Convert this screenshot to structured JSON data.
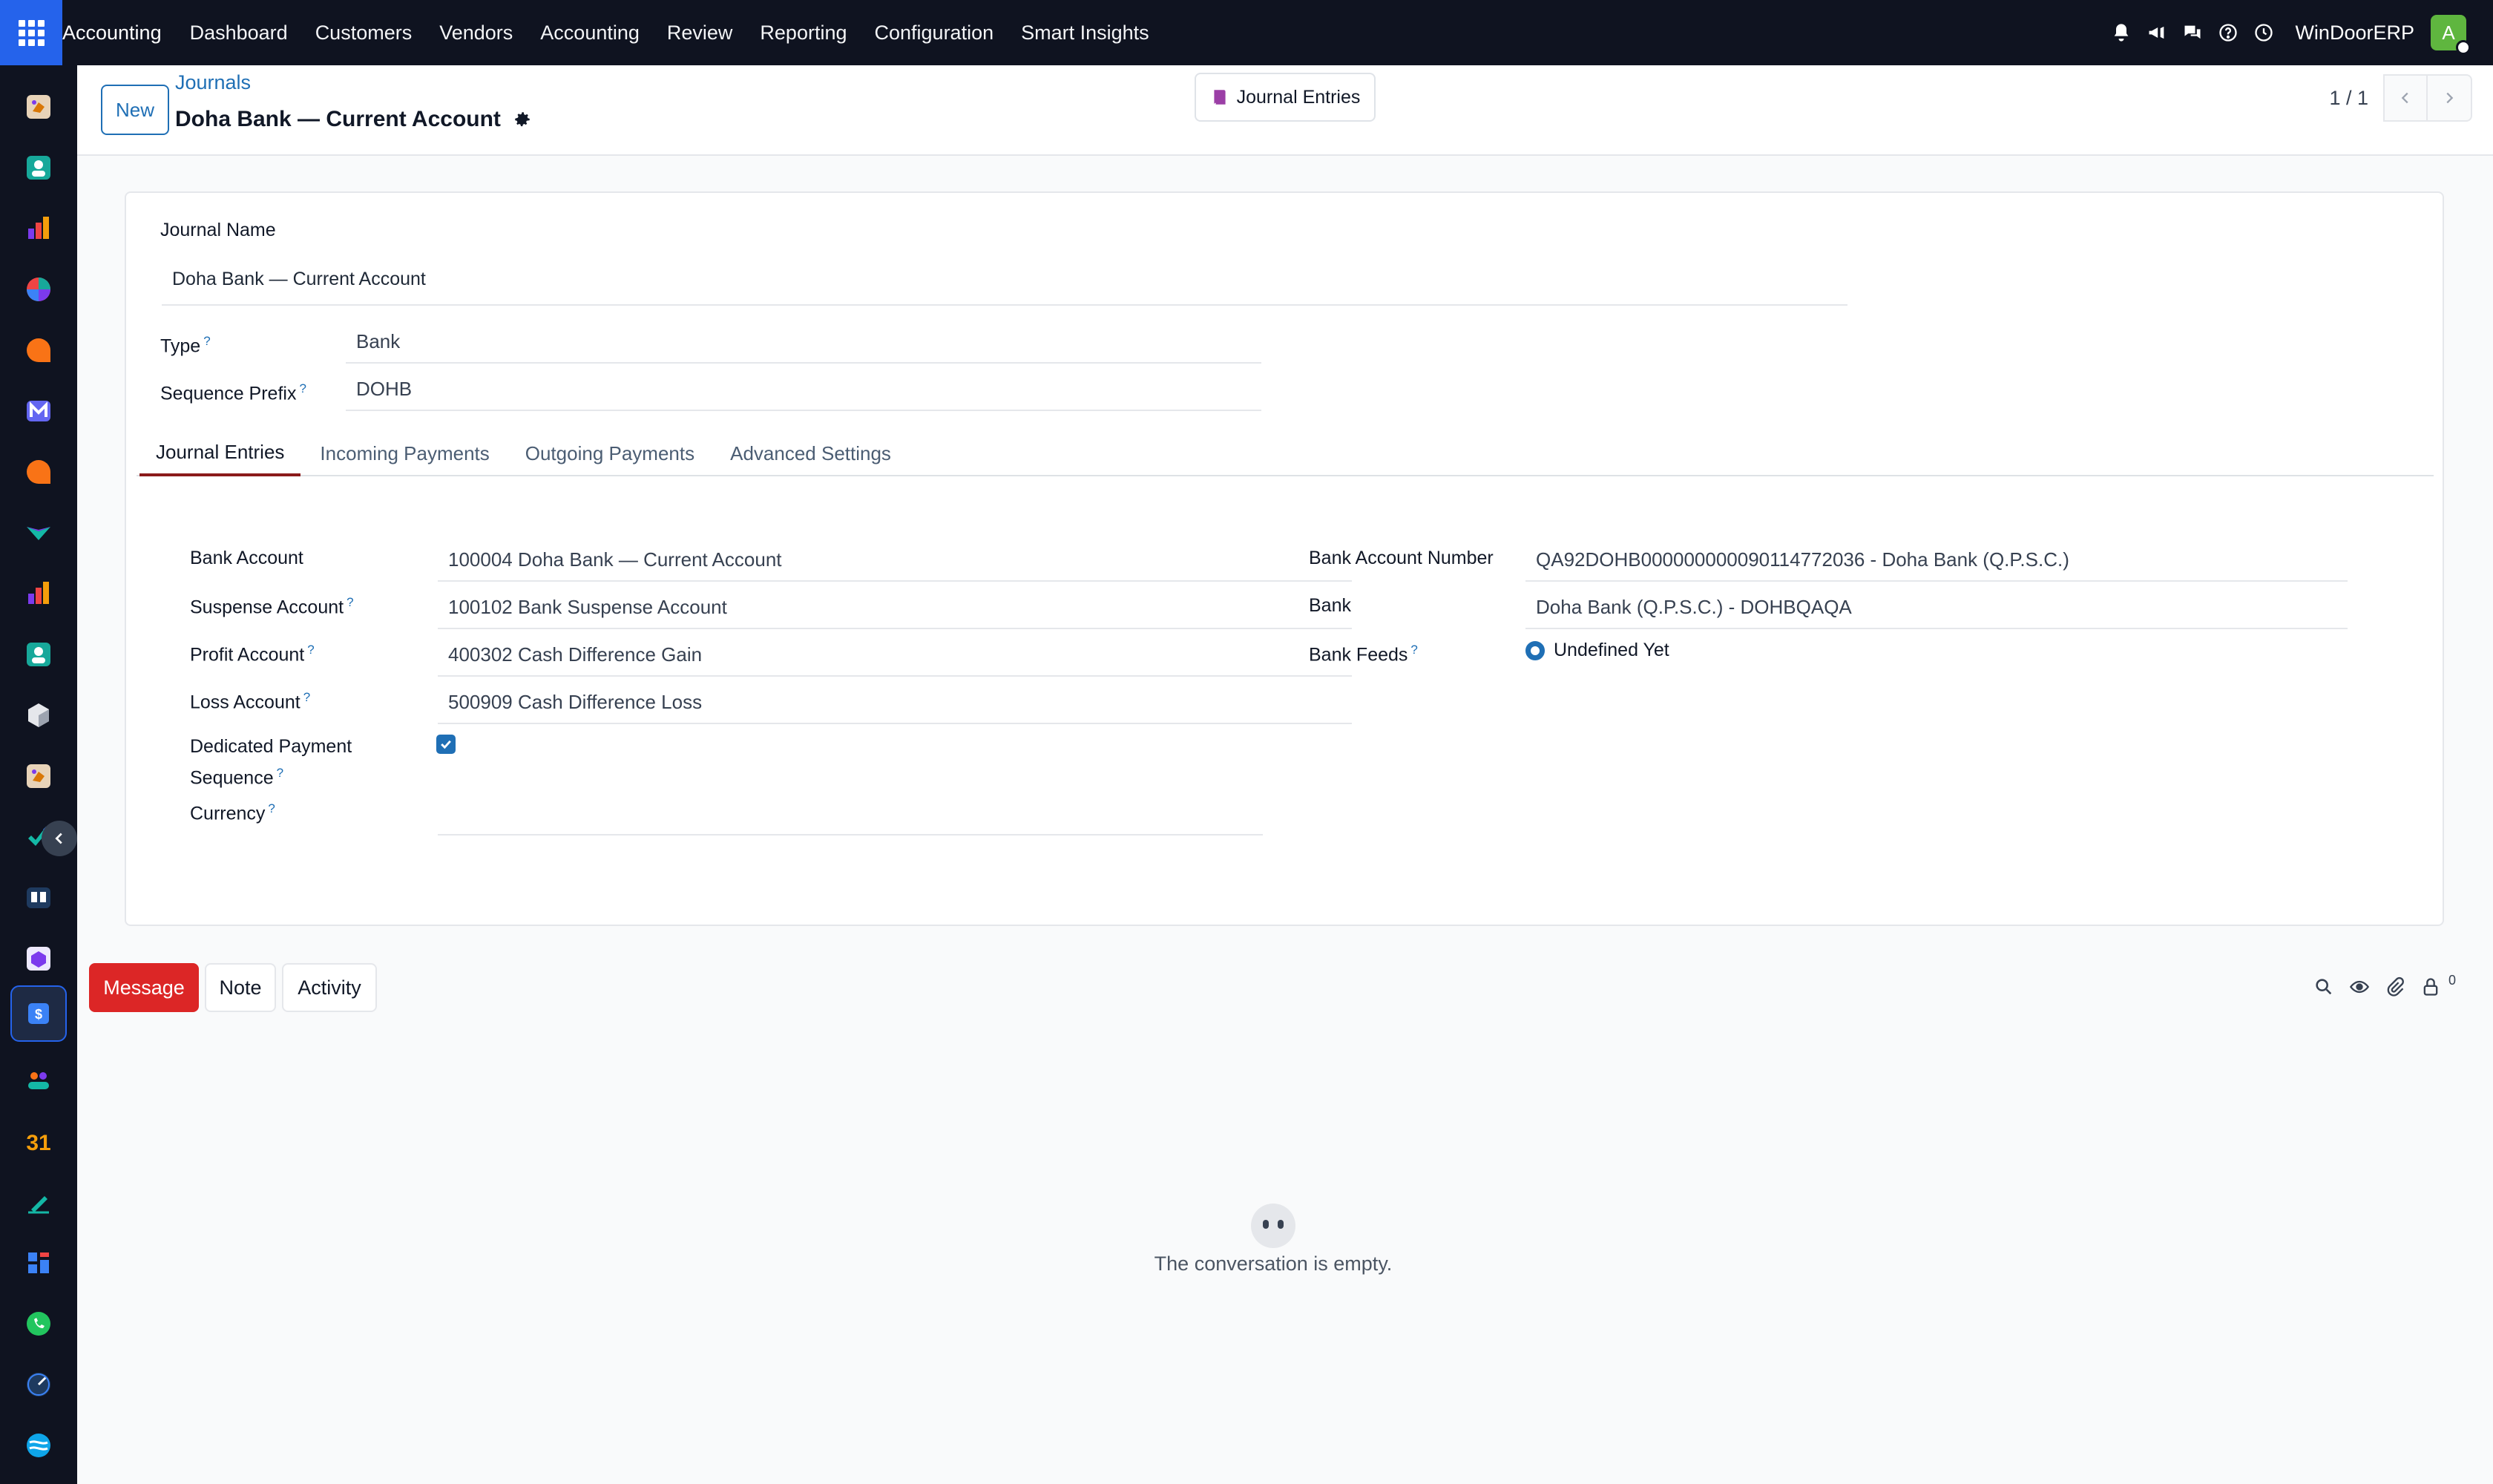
{
  "topbar": {
    "app_name": "Accounting",
    "menu": [
      "Dashboard",
      "Customers",
      "Vendors",
      "Accounting",
      "Review",
      "Reporting",
      "Configuration",
      "Smart Insights"
    ],
    "company": "WinDoorERP",
    "avatar_initial": "A",
    "icons": [
      "bell-icon",
      "megaphone-icon",
      "chat-icon",
      "help-icon",
      "clock-icon"
    ]
  },
  "sidebar": {
    "icons": [
      "sales-app-icon",
      "contacts-app-icon",
      "dashboard-app-icon",
      "pie-chart-app-icon",
      "discuss-app-icon",
      "mail-app-icon",
      "livechat-app-icon",
      "sign-app-icon",
      "reporting-app-icon",
      "contacts2-app-icon",
      "inventory-app-icon",
      "crm-app-icon",
      "tasks-app-icon",
      "knowledge-app-icon",
      "apps-app-icon",
      "accounting-app-icon",
      "employees-app-icon",
      "calendar-app-icon",
      "draw-app-icon",
      "website-app-icon",
      "whatsapp-app-icon",
      "planning-app-icon",
      "documents-app-icon"
    ],
    "calendar_day": "31",
    "active_index": 15
  },
  "control_panel": {
    "new_label": "New",
    "breadcrumb": "Journals",
    "record_title": "Doha Bank — Current Account",
    "smart_button": "Journal Entries",
    "pager": "1 / 1"
  },
  "form": {
    "journal_name_label": "Journal Name",
    "journal_name_value": "Doha Bank — Current Account",
    "type_label": "Type",
    "type_value": "Bank",
    "prefix_label": "Sequence Prefix",
    "prefix_value": "DOHB",
    "help_marker": "?",
    "tabs": [
      "Journal Entries",
      "Incoming Payments",
      "Outgoing Payments",
      "Advanced Settings"
    ],
    "left": {
      "bank_account_label": "Bank Account",
      "bank_account_value": "100004 Doha Bank — Current Account",
      "suspense_label": "Suspense Account",
      "suspense_value": "100102 Bank Suspense Account",
      "profit_label": "Profit Account",
      "profit_value": "400302 Cash Difference Gain",
      "loss_label": "Loss Account",
      "loss_value": "500909 Cash Difference Loss",
      "dedicated_label_1": "Dedicated Payment",
      "dedicated_label_2": "Sequence",
      "dedicated_checked": true,
      "currency_label": "Currency",
      "currency_value": ""
    },
    "right": {
      "acc_number_label": "Bank Account Number",
      "acc_number_value": "QA92DOHB000000000090114772036 - Doha Bank (Q.P.S.C.)",
      "bank_label": "Bank",
      "bank_value": "Doha Bank (Q.P.S.C.) - DOHBQAQA",
      "feeds_label": "Bank Feeds",
      "feeds_value": "Undefined Yet"
    }
  },
  "chatter": {
    "message_label": "Message",
    "note_label": "Note",
    "activity_label": "Activity",
    "followers_count": "0",
    "empty_text": "The conversation is empty."
  },
  "colors": {
    "topbar_bg": "#0f1320",
    "apps_button": "#2563eb",
    "primary_link": "#1f6fb5",
    "message_button": "#dc2626",
    "tab_active_border": "#8b1a1a",
    "avatar_bg": "#5fb63f"
  }
}
